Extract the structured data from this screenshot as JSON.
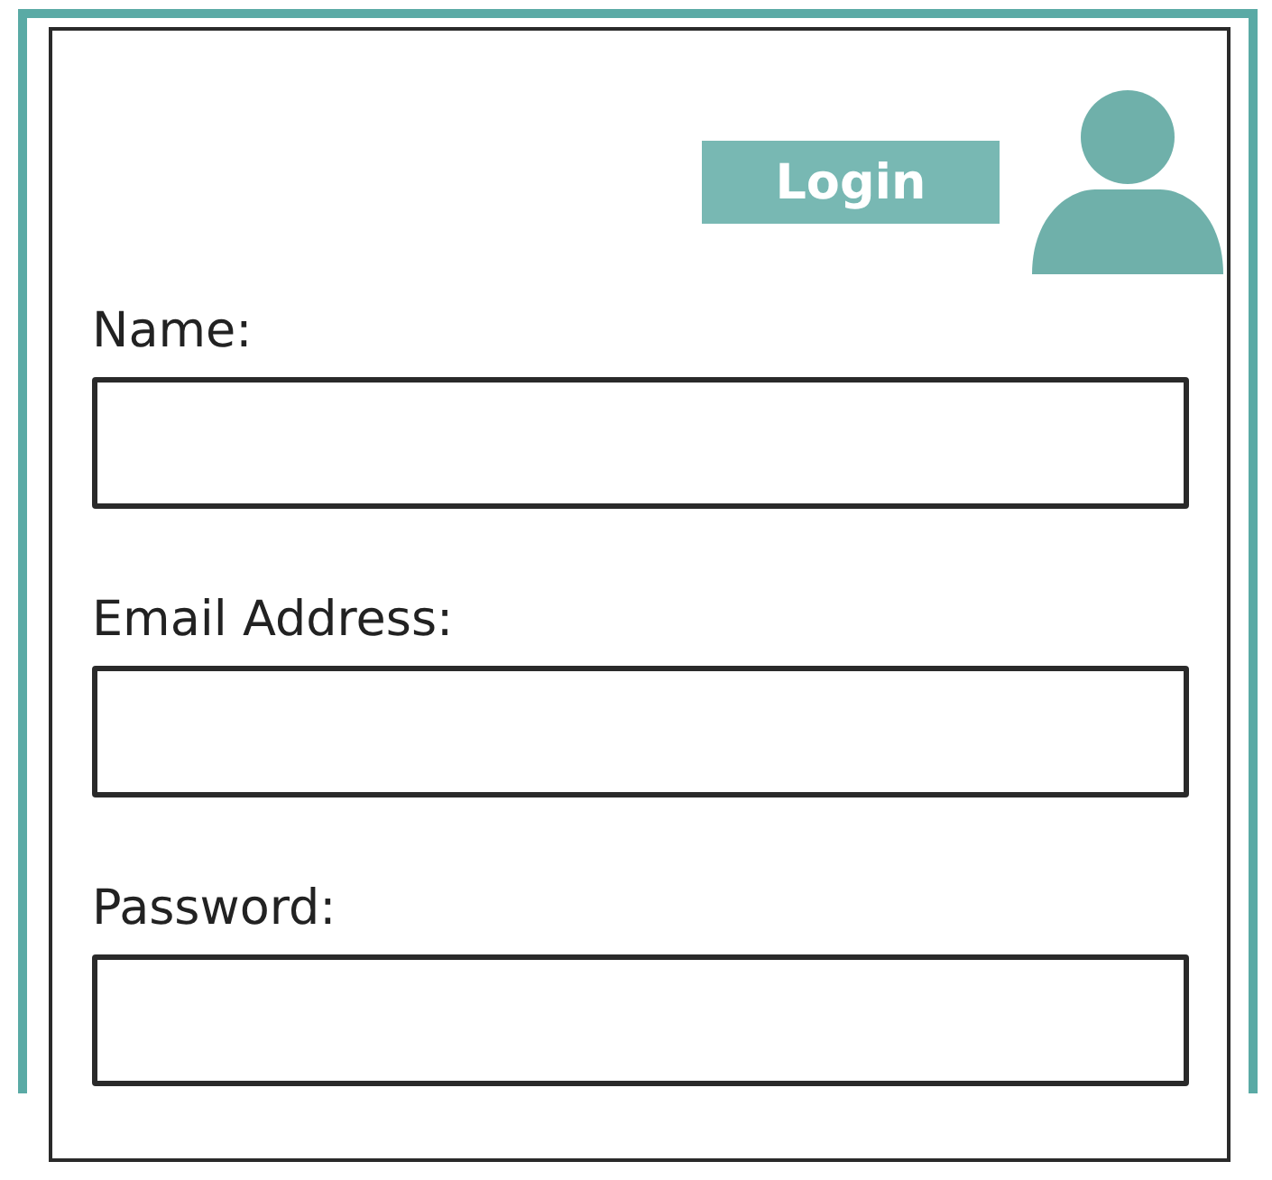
{
  "login_button": {
    "label": "Login"
  },
  "fields": [
    {
      "label": "Name:"
    },
    {
      "label": "Email Address:"
    },
    {
      "label": "Password:"
    }
  ]
}
